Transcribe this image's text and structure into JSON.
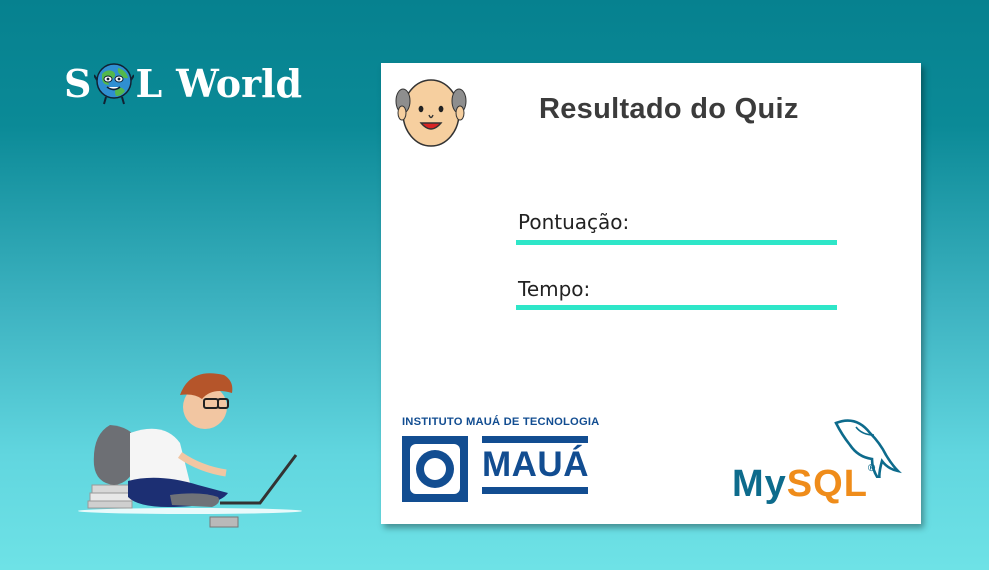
{
  "app": {
    "logo": {
      "s": "S",
      "l": "L",
      "world": "World"
    }
  },
  "result_card": {
    "title": "Resultado do Quiz",
    "score_label": "Pontuação:",
    "time_label": "Tempo:"
  },
  "sponsors": {
    "maua_top": "INSTITUTO MAUÁ DE TECNOLOGIA",
    "maua_name": "MAUÁ",
    "mysql_my": "My",
    "mysql_sql": "SQL",
    "mysql_reg": "®"
  },
  "colors": {
    "bg_top": "#06818f",
    "bg_bottom": "#6ee2e6",
    "field_line": "#2ee6c8",
    "maua_blue": "#124d91",
    "mysql_blue": "#0d6b8c",
    "mysql_orange": "#ef8c1a"
  }
}
